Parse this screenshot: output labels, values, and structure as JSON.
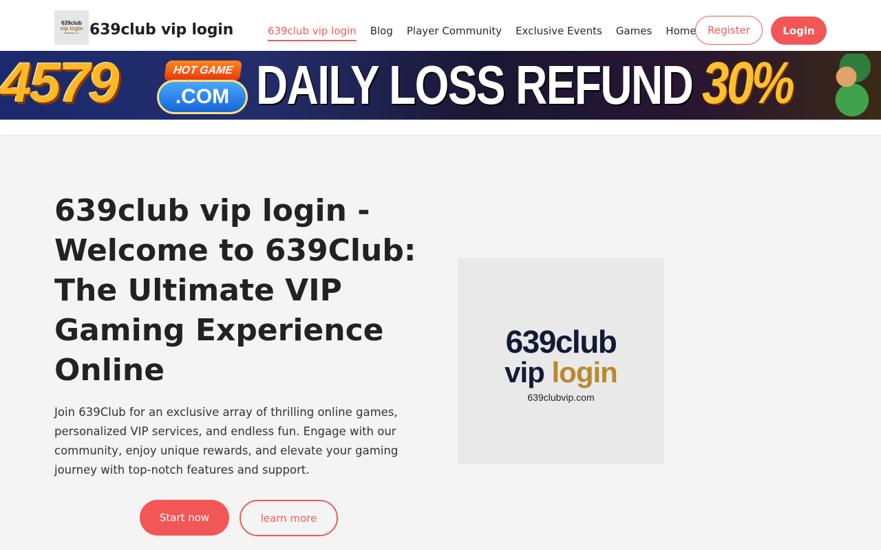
{
  "header": {
    "logo": {
      "line1": "639club",
      "line2": "vip login",
      "line3": "639clubvip.com"
    },
    "site_title": "639club vip login",
    "nav": [
      {
        "label": "639club vip login",
        "active": true
      },
      {
        "label": "Blog"
      },
      {
        "label": "Player Community"
      },
      {
        "label": "Exclusive Events"
      },
      {
        "label": "Games"
      },
      {
        "label": "Home"
      }
    ],
    "register_label": "Register",
    "login_label": "Login"
  },
  "banner": {
    "number": "4579",
    "hot_label": "HOT GAME",
    "domain": ".COM",
    "headline": "DAILY LOSS REFUND",
    "percent": "30%"
  },
  "hero": {
    "title": "639club vip login - Welcome to 639Club: The Ultimate VIP Gaming Experience Online",
    "description": "Join 639Club for an exclusive array of thrilling online games, personalized VIP services, and endless fun. Engage with our community, enjoy unique rewards, and elevate your gaming journey with top-notch features and support.",
    "start_label": "Start now",
    "learn_label": "learn more",
    "image": {
      "line1": "639club",
      "line2a": "vip ",
      "line2b": "login",
      "line3": "639clubvip.com"
    }
  },
  "colors": {
    "accent": "#f25656",
    "background": "#f4f4f4"
  }
}
